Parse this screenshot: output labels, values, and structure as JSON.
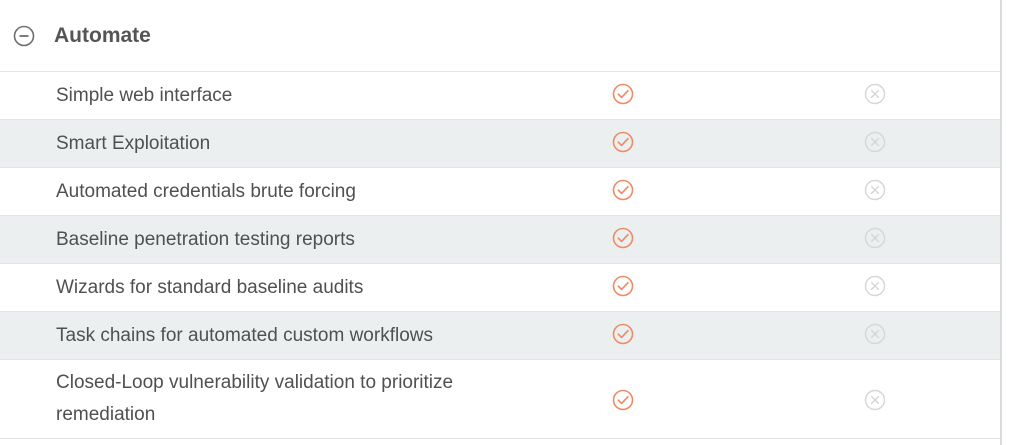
{
  "section": {
    "title": "Automate",
    "collapse_icon": "minus-circle-icon"
  },
  "columns": [
    {
      "name": "column-a",
      "icon": "check-circle-icon",
      "color": "#f08a63"
    },
    {
      "name": "column-b",
      "icon": "x-circle-icon",
      "color": "#d6d6d6"
    }
  ],
  "features": [
    {
      "label": "Simple web interface",
      "column_a": "included",
      "column_b": "not-included"
    },
    {
      "label": "Smart Exploitation",
      "column_a": "included",
      "column_b": "not-included"
    },
    {
      "label": "Automated credentials brute forcing",
      "column_a": "included",
      "column_b": "not-included"
    },
    {
      "label": "Baseline penetration testing reports",
      "column_a": "included",
      "column_b": "not-included"
    },
    {
      "label": "Wizards for standard baseline audits",
      "column_a": "included",
      "column_b": "not-included"
    },
    {
      "label": "Task chains for automated custom workflows",
      "column_a": "included",
      "column_b": "not-included"
    },
    {
      "label": "Closed-Loop vulnerability validation to prioritize remediation",
      "column_a": "included",
      "column_b": "not-included"
    }
  ]
}
